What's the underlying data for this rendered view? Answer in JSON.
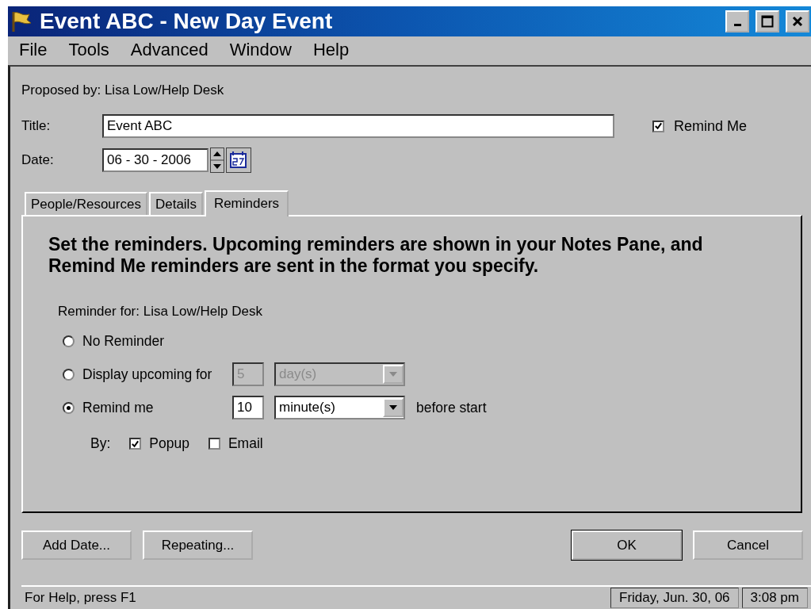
{
  "window": {
    "title": "Event ABC - New Day Event"
  },
  "menu": [
    "File",
    "Tools",
    "Advanced",
    "Window",
    "Help"
  ],
  "proposed_by": "Proposed by: Lisa Low/Help Desk",
  "title_field": {
    "label": "Title:",
    "value": "Event ABC"
  },
  "remind_me": {
    "label": "Remind Me",
    "checked": true
  },
  "date_field": {
    "label": "Date:",
    "value": "06 - 30 - 2006"
  },
  "tabs": [
    {
      "label": "People/Resources",
      "selected": false
    },
    {
      "label": "Details",
      "selected": false
    },
    {
      "label": "Reminders",
      "selected": true
    }
  ],
  "reminders": {
    "heading": "Set the reminders. Upcoming reminders are shown in your Notes Pane, and Remind Me reminders are sent in the format you specify.",
    "reminder_for": "Reminder for: Lisa Low/Help Desk",
    "options": [
      {
        "kind": "plain",
        "label": "No Reminder",
        "selected": false
      },
      {
        "kind": "amount",
        "label": "Display upcoming for",
        "selected": false,
        "number": "5",
        "unit": "day(s)",
        "disabled": true
      },
      {
        "kind": "amount",
        "label": "Remind me",
        "selected": true,
        "number": "10",
        "unit": "minute(s)",
        "disabled": false,
        "suffix": "before start"
      }
    ],
    "by": {
      "label": "By:",
      "methods": [
        {
          "label": "Popup",
          "checked": true
        },
        {
          "label": "Email",
          "checked": false
        }
      ]
    }
  },
  "buttons_left": [
    "Add Date...",
    "Repeating..."
  ],
  "buttons_right": [
    {
      "label": "OK",
      "default": true
    },
    {
      "label": "Cancel",
      "default": false
    }
  ],
  "status_bar": {
    "help": "For Help, press F1",
    "date": "Friday, Jun. 30, 06",
    "time": "3:08 pm"
  }
}
